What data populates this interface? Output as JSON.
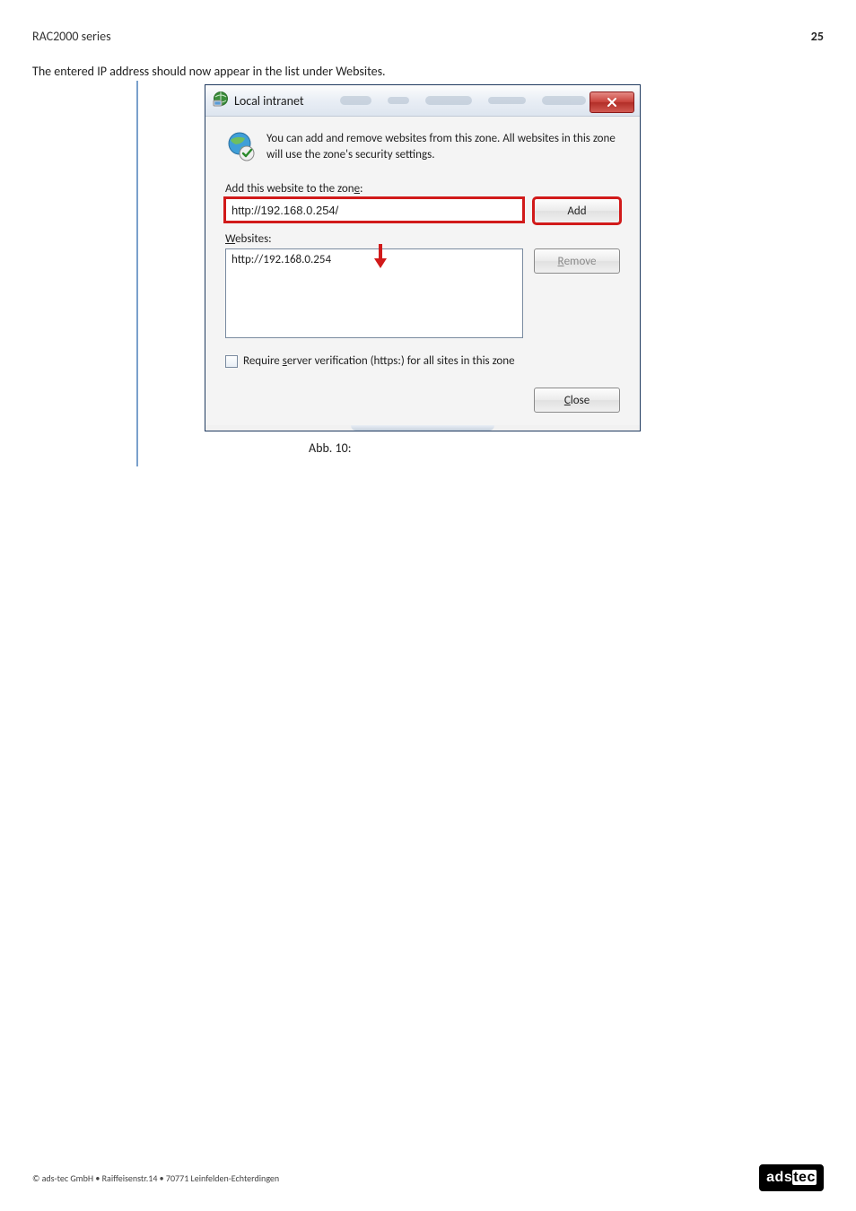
{
  "header": {
    "product": "RAC2000 series",
    "page_number": "25"
  },
  "intro_line": "The entered IP address should now appear in the list under Websites.",
  "dialog": {
    "title": "Local intranet",
    "description": "You can add and remove websites from this zone. All websites in this zone will use the zone's security settings.",
    "add_label_pre": "Add this website to the zon",
    "add_label_u": "e",
    "add_label_post": ":",
    "input_value": "http://192.168.0.254/",
    "add_button": "Add",
    "websites_label_u": "W",
    "websites_label_post": "ebsites:",
    "list_item": "http://192.168.0.254",
    "remove_pre": "R",
    "remove_post": "emove",
    "checkbox_pre": "Require ",
    "checkbox_u": "s",
    "checkbox_post": "erver verification (https:) for all sites in this zone",
    "close_pre": "C",
    "close_post": "lose"
  },
  "caption": "Abb. 10:",
  "footer": {
    "copyright": "© ads-tec GmbH • Raiffeisenstr.14 • 70771 Leinfelden-Echterdingen"
  }
}
